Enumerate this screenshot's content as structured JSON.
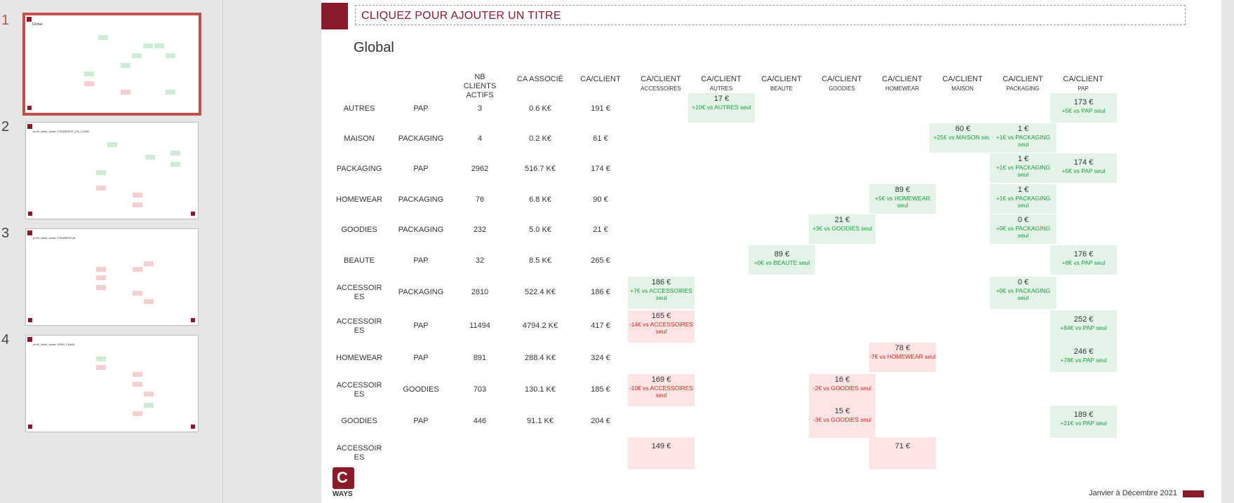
{
  "slides_panel": {
    "thumbnails": [
      {
        "number": "1",
        "title": "Global",
        "active": true
      },
      {
        "number": "2",
        "title": "profil_client_canal: COMMERCE_EN_LIGNE",
        "active": false
      },
      {
        "number": "3",
        "title": "profil_client_canal: COMMERCIAL",
        "active": false
      },
      {
        "number": "4",
        "title": "profil_client_canal: OMNI_CANAL",
        "active": false
      }
    ]
  },
  "slide": {
    "title_placeholder": "CLIQUEZ POUR AJOUTER UN TITRE",
    "subtitle": "Global",
    "headers": [
      {
        "main": "NB CLIENTS ACTIFS",
        "sub": ""
      },
      {
        "main": "CA ASSOCIÉ",
        "sub": ""
      },
      {
        "main": "CA/CLIENT",
        "sub": ""
      },
      {
        "main": "CA/CLIENT",
        "sub": "ACCESSOIRES"
      },
      {
        "main": "CA/CLIENT",
        "sub": "AUTRES"
      },
      {
        "main": "CA/CLIENT",
        "sub": "BEAUTE"
      },
      {
        "main": "CA/CLIENT",
        "sub": "GOODIES"
      },
      {
        "main": "CA/CLIENT",
        "sub": "HOMEWEAR"
      },
      {
        "main": "CA/CLIENT",
        "sub": "MAISON"
      },
      {
        "main": "CA/CLIENT",
        "sub": "PACKAGING"
      },
      {
        "main": "CA/CLIENT",
        "sub": "PAP"
      }
    ],
    "rows": [
      {
        "cat1": "AUTRES",
        "cat2": "PAP",
        "nb": "3",
        "ca": "0.6 K€",
        "cacl": "191 €",
        "tiles": [
          {
            "col": "AUTRES",
            "color": "green",
            "val": "17 €",
            "diff": "+10€ vs AUTRES seul"
          },
          {
            "col": "PAP",
            "color": "green",
            "val": "173 €",
            "diff": "+5€ vs PAP seul"
          }
        ]
      },
      {
        "cat1": "MAISON",
        "cat2": "PACKAGING",
        "nb": "4",
        "ca": "0.2 K€",
        "cacl": "61 €",
        "tiles": [
          {
            "col": "MAISON",
            "color": "green",
            "val": "60 €",
            "diff": "+25€ vs MAISON seul"
          },
          {
            "col": "PACKAGING",
            "color": "green",
            "val": "1 €",
            "diff": "+1€ vs PACKAGING seul"
          }
        ]
      },
      {
        "cat1": "PACKAGING",
        "cat2": "PAP",
        "nb": "2962",
        "ca": "516.7 K€",
        "cacl": "174 €",
        "tiles": [
          {
            "col": "PACKAGING",
            "color": "green",
            "val": "1 €",
            "diff": "+1€ vs PACKAGING seul"
          },
          {
            "col": "PAP",
            "color": "green",
            "val": "174 €",
            "diff": "+5€ vs PAP seul"
          }
        ]
      },
      {
        "cat1": "HOMEWEAR",
        "cat2": "PACKAGING",
        "nb": "76",
        "ca": "6.8 K€",
        "cacl": "90 €",
        "tiles": [
          {
            "col": "HOMEWEAR",
            "color": "green",
            "val": "89 €",
            "diff": "+5€ vs HOMEWEAR seul"
          },
          {
            "col": "PACKAGING",
            "color": "green",
            "val": "1 €",
            "diff": "+1€ vs PACKAGING seul"
          }
        ]
      },
      {
        "cat1": "GOODIES",
        "cat2": "PACKAGING",
        "nb": "232",
        "ca": "5.0 K€",
        "cacl": "21 €",
        "tiles": [
          {
            "col": "GOODIES",
            "color": "green",
            "val": "21 €",
            "diff": "+3€ vs GOODIES seul"
          },
          {
            "col": "PACKAGING",
            "color": "green",
            "val": "0 €",
            "diff": "+0€ vs PACKAGING seul"
          }
        ]
      },
      {
        "cat1": "BEAUTE",
        "cat2": "PAP",
        "nb": "32",
        "ca": "8.5 K€",
        "cacl": "265 €",
        "tiles": [
          {
            "col": "BEAUTE",
            "color": "green",
            "val": "89 €",
            "diff": "+0€ vs BEAUTE seul"
          },
          {
            "col": "PAP",
            "color": "green",
            "val": "176 €",
            "diff": "+8€ vs PAP seul"
          }
        ]
      },
      {
        "cat1": "ACCESSOIRES",
        "cat2": "PACKAGING",
        "nb": "2810",
        "ca": "522.4 K€",
        "cacl": "186 €",
        "tiles": [
          {
            "col": "ACCESSOIRES",
            "color": "green",
            "val": "186 €",
            "diff": "+7€ vs ACCESSOIRES seul"
          },
          {
            "col": "PACKAGING",
            "color": "green",
            "val": "0 €",
            "diff": "+0€ vs PACKAGING seul"
          }
        ]
      },
      {
        "cat1": "ACCESSOIRES",
        "cat2": "PAP",
        "nb": "11494",
        "ca": "4794.2 K€",
        "cacl": "417 €",
        "tiles": [
          {
            "col": "ACCESSOIRES",
            "color": "red",
            "val": "165 €",
            "diff": "-14€ vs ACCESSOIRES seul"
          },
          {
            "col": "PAP",
            "color": "green",
            "val": "252 €",
            "diff": "+84€ vs PAP seul"
          }
        ]
      },
      {
        "cat1": "HOMEWEAR",
        "cat2": "PAP",
        "nb": "891",
        "ca": "288.4 K€",
        "cacl": "324 €",
        "tiles": [
          {
            "col": "HOMEWEAR",
            "color": "red",
            "val": "78 €",
            "diff": "-7€ vs HOMEWEAR seul"
          },
          {
            "col": "PAP",
            "color": "green",
            "val": "246 €",
            "diff": "+78€ vs PAP seul"
          }
        ]
      },
      {
        "cat1": "ACCESSOIRES",
        "cat2": "GOODIES",
        "nb": "703",
        "ca": "130.1 K€",
        "cacl": "185 €",
        "tiles": [
          {
            "col": "ACCESSOIRES",
            "color": "red",
            "val": "169 €",
            "diff": "-10€ vs ACCESSOIRES seul"
          },
          {
            "col": "GOODIES",
            "color": "red",
            "val": "16 €",
            "diff": "-2€ vs GOODIES seul"
          }
        ]
      },
      {
        "cat1": "GOODIES",
        "cat2": "PAP",
        "nb": "446",
        "ca": "91.1 K€",
        "cacl": "204 €",
        "tiles": [
          {
            "col": "GOODIES",
            "color": "red",
            "val": "15 €",
            "diff": "-3€ vs GOODIES seul"
          },
          {
            "col": "PAP",
            "color": "green",
            "val": "189 €",
            "diff": "+21€ vs PAP seul"
          }
        ]
      },
      {
        "cat1": "ACCESSOIRES",
        "cat2": "",
        "nb": "",
        "ca": "",
        "cacl": "",
        "tiles": [
          {
            "col": "ACCESSOIRES",
            "color": "red",
            "val": "149 €",
            "diff": ""
          },
          {
            "col": "HOMEWEAR",
            "color": "red",
            "val": "71 €",
            "diff": ""
          }
        ]
      }
    ],
    "logo_letter": "C",
    "logo_text": "WAYS",
    "footer_date": "Janvier à Décembre 2021"
  },
  "colors": {
    "brand": "#8b1a2b",
    "positive": "#1aa13f",
    "negative": "#e2231a",
    "positive_bg": "#e3f3e7",
    "negative_bg": "#fce4e4"
  }
}
